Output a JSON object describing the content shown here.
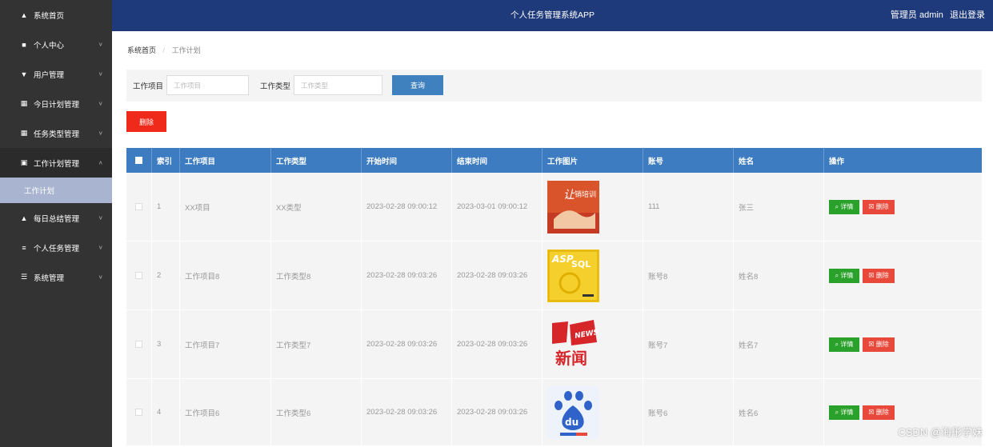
{
  "sidebar": {
    "items": [
      {
        "label": "系统首页",
        "icon": "home-icon",
        "glyph": "▲",
        "chevron": false
      },
      {
        "label": "个人中心",
        "icon": "user-icon",
        "glyph": "■",
        "chevron": true,
        "chev_glyph": "˅"
      },
      {
        "label": "用户管理",
        "icon": "users-icon",
        "glyph": "▼",
        "chevron": true,
        "chev_glyph": "˅"
      },
      {
        "label": "今日计划管理",
        "icon": "grid-icon",
        "glyph": "▦",
        "chevron": true,
        "chev_glyph": "˅"
      },
      {
        "label": "任务类型管理",
        "icon": "grid-icon",
        "glyph": "▦",
        "chevron": true,
        "chev_glyph": "˅"
      },
      {
        "label": "工作计划管理",
        "icon": "clipboard-icon",
        "glyph": "▣",
        "chevron": true,
        "chev_glyph": "˄",
        "open": true
      },
      {
        "label": "每日总结管理",
        "icon": "person-icon",
        "glyph": "▲",
        "chevron": true,
        "chev_glyph": "˅"
      },
      {
        "label": "个人任务管理",
        "icon": "list-icon",
        "glyph": "≡",
        "chevron": true,
        "chev_glyph": "˅"
      },
      {
        "label": "系统管理",
        "icon": "sliders-icon",
        "glyph": "☰",
        "chevron": true,
        "chev_glyph": "˅"
      }
    ],
    "active_sub": "工作计划"
  },
  "header": {
    "title": "个人任务管理系统APP",
    "admin_label": "管理员 admin",
    "logout": "退出登录"
  },
  "breadcrumb": {
    "home": "系统首页",
    "sep": "/",
    "current": "工作计划"
  },
  "search": {
    "item_label": "工作项目",
    "item_placeholder": "工作项目",
    "type_label": "工作类型",
    "type_placeholder": "工作类型",
    "query_button": "查询"
  },
  "toolbar": {
    "delete_label": "删除"
  },
  "table": {
    "headers": [
      "索引",
      "工作项目",
      "工作类型",
      "开始时间",
      "结束时间",
      "工作图片",
      "账号",
      "姓名",
      "操作"
    ],
    "rows": [
      {
        "index": "1",
        "item": "XX项目",
        "type": "XX类型",
        "start": "2023-02-28 09:00:12",
        "end": "2023-03-01 09:00:12",
        "image": "training-image",
        "account": "111",
        "name": "张三"
      },
      {
        "index": "2",
        "item": "工作项目8",
        "type": "工作类型8",
        "start": "2023-02-28 09:03:26",
        "end": "2023-02-28 09:03:26",
        "image": "asp-sql-book-image",
        "account": "账号8",
        "name": "姓名8"
      },
      {
        "index": "3",
        "item": "工作项目7",
        "type": "工作类型7",
        "start": "2023-02-28 09:03:26",
        "end": "2023-02-28 09:03:26",
        "image": "news-logo-image",
        "account": "账号7",
        "name": "姓名7"
      },
      {
        "index": "4",
        "item": "工作项目6",
        "type": "工作类型6",
        "start": "2023-02-28 09:03:26",
        "end": "2023-02-28 09:03:26",
        "image": "baidu-logo-image",
        "account": "账号6",
        "name": "姓名6"
      }
    ],
    "detail_label": "详情",
    "delete_label": "删除",
    "detail_icon": "⌕",
    "delete_icon": "☒"
  },
  "image_text": {
    "training_top": "让",
    "training_main": "销培训",
    "asp_top": "ASP",
    "asp_bottom": "SQL",
    "news_en": "NEWS",
    "news_cn": "新闻",
    "baidu": "du"
  },
  "watermark": "CSDN @海彤学妹",
  "colors": {
    "sidebar_bg": "#333333",
    "topbar_bg": "#1f3a7a",
    "table_header_bg": "#3e7cc1",
    "query_button": "#3f80bf",
    "delete_button": "#f02a1a",
    "detail_button": "#2aa12a",
    "row_delete_button": "#e8493a",
    "active_sub_bg": "#a9b4d0"
  }
}
